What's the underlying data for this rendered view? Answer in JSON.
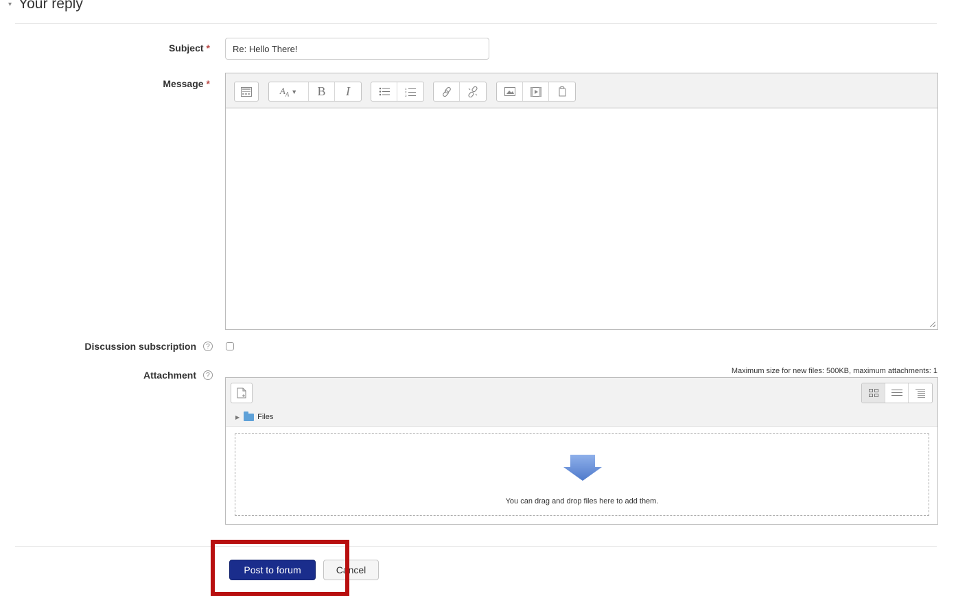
{
  "section": {
    "title": "Your reply"
  },
  "form": {
    "subject": {
      "label": "Subject",
      "required_mark": "*",
      "value": "Re: Hello There!"
    },
    "message": {
      "label": "Message",
      "required_mark": "*",
      "value": ""
    },
    "subscription": {
      "label": "Discussion subscription",
      "help": "?",
      "checked": false
    },
    "attachment": {
      "label": "Attachment",
      "help": "?",
      "max_size_text": "Maximum size for new files: 500KB, maximum attachments: 1",
      "path_label": "Files",
      "drop_text": "You can drag and drop files here to add them."
    }
  },
  "editor_toolbar": {
    "icons": [
      "toolbar-toggle-icon",
      "font-style-icon",
      "bold-icon",
      "italic-icon",
      "unordered-list-icon",
      "ordered-list-icon",
      "link-icon",
      "unlink-icon",
      "image-icon",
      "media-icon",
      "manage-files-icon"
    ]
  },
  "buttons": {
    "submit": "Post to forum",
    "cancel": "Cancel"
  },
  "colors": {
    "primary_button": "#1a2d8c",
    "required": "#b94a48",
    "highlight_box": "#b80f0f",
    "drop_arrow": "#6a8fd6"
  }
}
